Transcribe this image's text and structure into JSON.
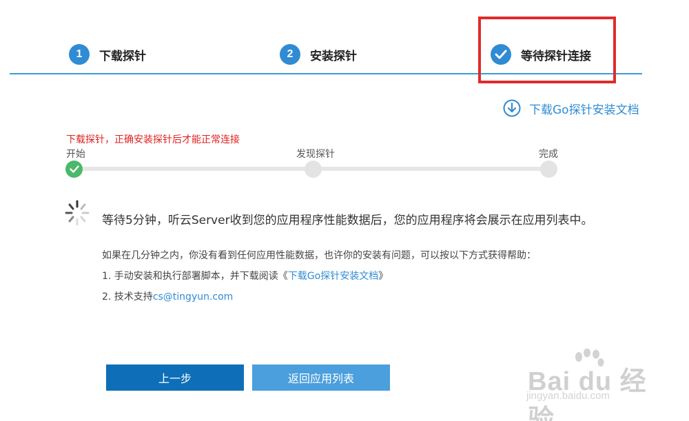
{
  "steps": [
    {
      "number": "1",
      "label": "下载探针"
    },
    {
      "number": "2",
      "label": "安装探针"
    },
    {
      "label": "等待探针连接"
    }
  ],
  "doc_link": {
    "label": "下载Go探针安装文档",
    "icon": "download-circle-icon"
  },
  "warning": "下载探针，正确安装探针后才能正常连接",
  "progress": {
    "start_label": "开始",
    "mid_label": "发现探针",
    "end_label": "完成"
  },
  "wait_message": "等待5分钟，听云Server收到您的应用程序性能数据后，您的应用程序将会展示在应用列表中。",
  "help": {
    "intro": "如果在几分钟之内，你没有看到任何应用性能数据，也许你的安装有问题，可以按以下方式获得帮助：",
    "item1_prefix": "1. 手动安装和执行部署脚本，并下载阅读《",
    "item1_link": "下载Go探针安装文档",
    "item1_suffix": "》",
    "item2_prefix": "2. 技术支持",
    "item2_link": "cs@tingyun.com"
  },
  "buttons": {
    "prev": "上一步",
    "back": "返回应用列表"
  },
  "watermark": {
    "logo": "Bai du 经验",
    "url": "jingyan.baidu.com"
  },
  "colors": {
    "accent": "#2f8bd3",
    "warning": "#e02020",
    "success": "#4cb86a",
    "highlight": "#e02b2b"
  }
}
